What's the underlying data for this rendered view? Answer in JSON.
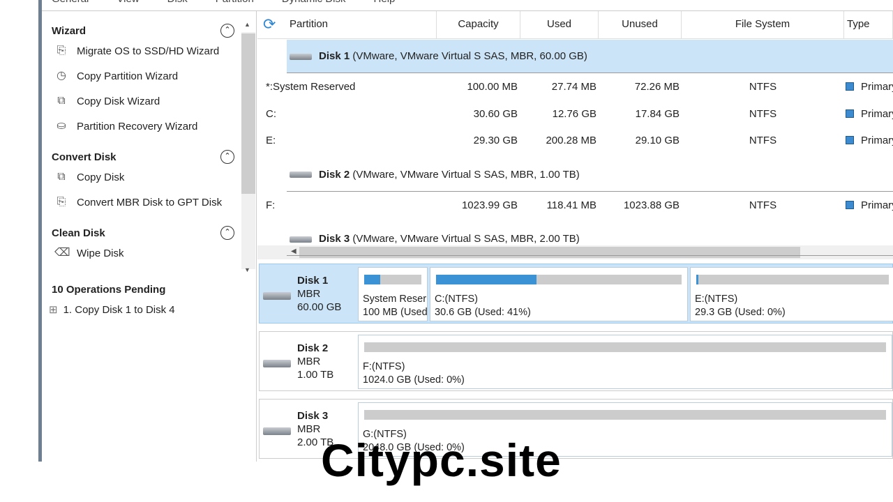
{
  "menu": [
    "General",
    "View",
    "Disk",
    "Partition",
    "Dynamic Disk",
    "Help"
  ],
  "sidebar": {
    "sections": [
      {
        "title": "Wizard",
        "items": [
          "Migrate OS to SSD/HD Wizard",
          "Copy Partition Wizard",
          "Copy Disk Wizard",
          "Partition Recovery Wizard"
        ]
      },
      {
        "title": "Convert Disk",
        "items": [
          "Copy Disk",
          "Convert MBR Disk to GPT Disk"
        ]
      },
      {
        "title": "Clean Disk",
        "items": [
          "Wipe Disk"
        ]
      }
    ],
    "pending_title": "10 Operations Pending",
    "pending_items": [
      "1. Copy Disk 1 to Disk 4"
    ]
  },
  "table": {
    "columns": [
      "Partition",
      "Capacity",
      "Used",
      "Unused",
      "File System",
      "Type"
    ],
    "disks": [
      {
        "name": "Disk 1",
        "desc": "(VMware, VMware Virtual S SAS, MBR, 60.00 GB)",
        "selected": true,
        "rows": [
          [
            "*:System Reserved",
            "100.00 MB",
            "27.74 MB",
            "72.26 MB",
            "NTFS",
            "Primary"
          ],
          [
            "C:",
            "30.60 GB",
            "12.76 GB",
            "17.84 GB",
            "NTFS",
            "Primary"
          ],
          [
            "E:",
            "29.30 GB",
            "200.28 MB",
            "29.10 GB",
            "NTFS",
            "Primary"
          ]
        ]
      },
      {
        "name": "Disk 2",
        "desc": "(VMware, VMware Virtual S SAS, MBR, 1.00 TB)",
        "rows": [
          [
            "F:",
            "1023.99 GB",
            "118.41 MB",
            "1023.88 GB",
            "NTFS",
            "Primary"
          ]
        ]
      },
      {
        "name": "Disk 3",
        "desc": "(VMware, VMware Virtual S SAS, MBR, 2.00 TB)",
        "rows": []
      }
    ]
  },
  "map": [
    {
      "name": "Disk 1",
      "style": "MBR",
      "size": "60.00 GB",
      "parts": [
        {
          "label": "System Reser",
          "sub": "100 MB (Used",
          "used_pct": 28
        },
        {
          "label": "C:(NTFS)",
          "sub": "30.6 GB (Used: 41%)",
          "used_pct": 41
        },
        {
          "label": "E:(NTFS)",
          "sub": "29.3 GB (Used: 0%)",
          "used_pct": 1
        }
      ]
    },
    {
      "name": "Disk 2",
      "style": "MBR",
      "size": "1.00 TB",
      "parts": [
        {
          "label": "F:(NTFS)",
          "sub": "1024.0 GB (Used: 0%)",
          "used_pct": 0
        }
      ]
    },
    {
      "name": "Disk 3",
      "style": "MBR",
      "size": "2.00 TB",
      "parts": [
        {
          "label": "G:(NTFS)",
          "sub": "2048.0 GB (Used: 0%)",
          "used_pct": 0
        }
      ]
    }
  ],
  "watermark": "Citypc.site",
  "colors": {
    "accent": "#3b93d6",
    "selected_row": "#cce4f7"
  }
}
